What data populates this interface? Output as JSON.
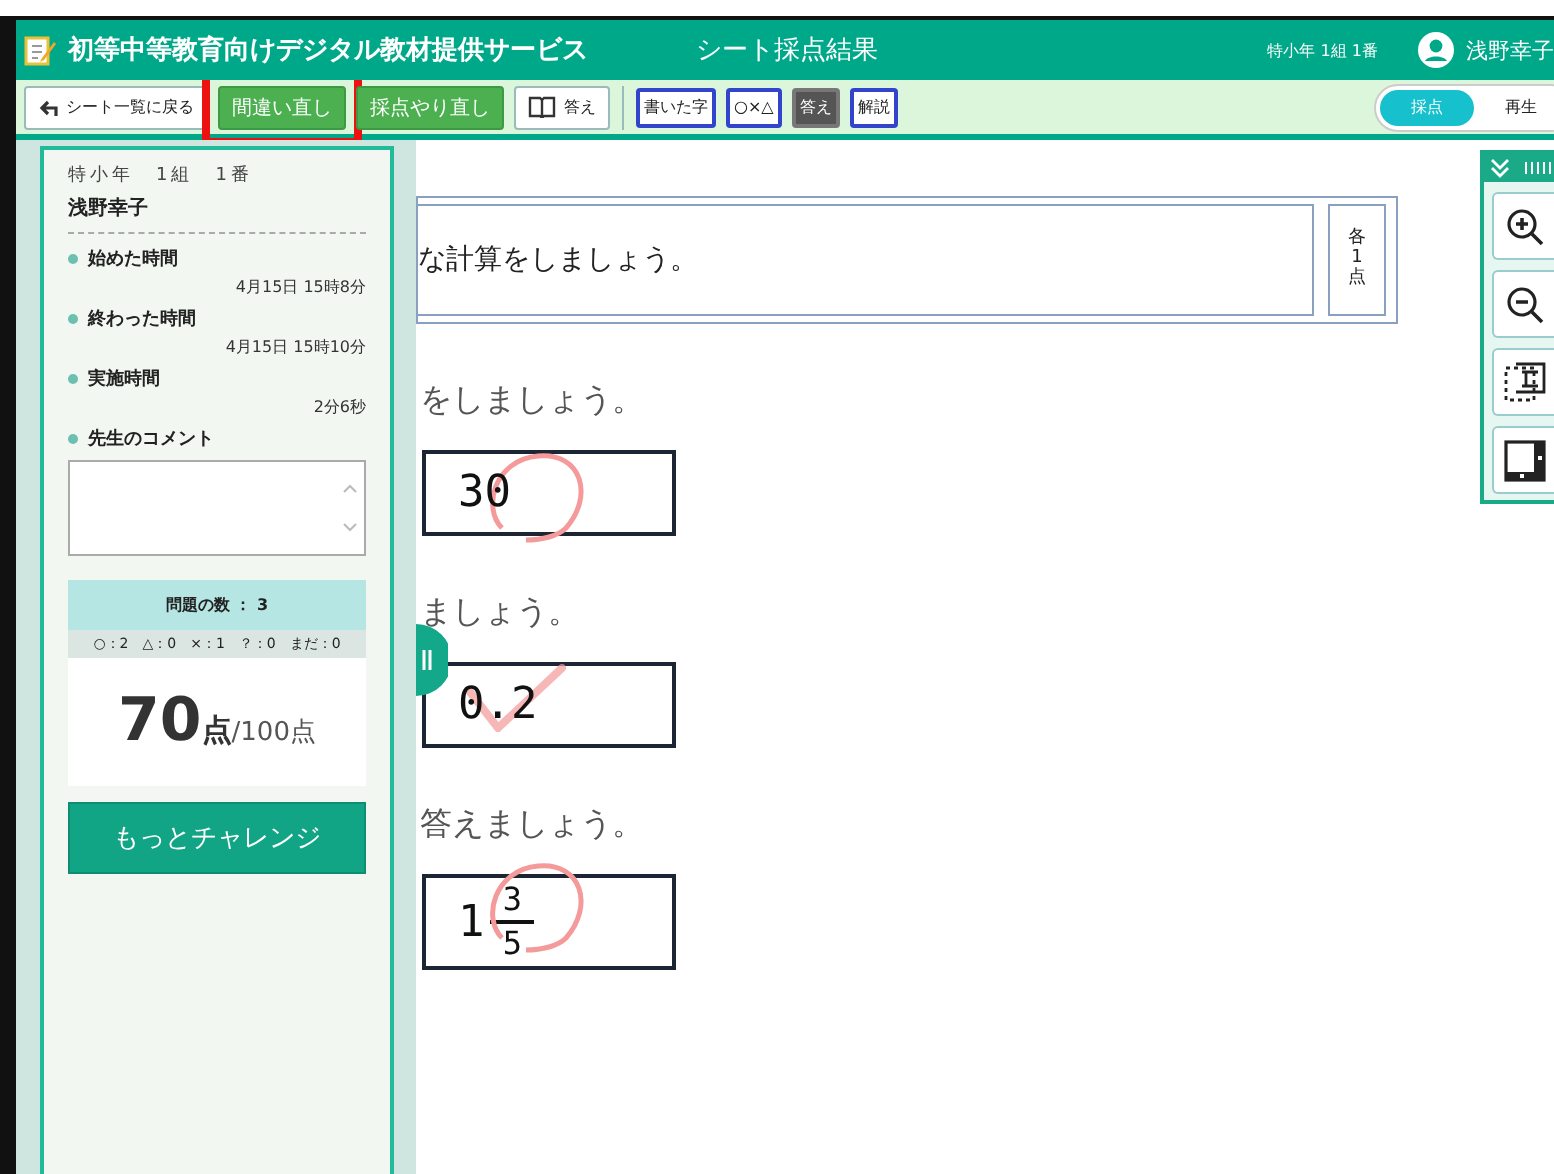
{
  "header": {
    "app_title": "初等中等教育向けデジタル教材提供サービス",
    "page_title": "シート採点結果",
    "class_info": "特小年 1組 1番",
    "user_name": "浅野幸子"
  },
  "toolbar": {
    "buttons": [
      {
        "kind": "back",
        "label": "シート一覧に戻る",
        "highlighted": false
      },
      {
        "kind": "action",
        "label": "間違い直し",
        "highlighted": true
      },
      {
        "kind": "action",
        "label": "採点やり直し",
        "highlighted": false
      },
      {
        "kind": "book",
        "label": "答え",
        "highlighted": false
      }
    ],
    "toggles": [
      {
        "label": "書いた字",
        "selected": false
      },
      {
        "label": "○×△",
        "selected": false
      },
      {
        "label": "答え",
        "selected": true
      },
      {
        "label": "解説",
        "selected": false
      }
    ],
    "mode": [
      {
        "label": "採点",
        "selected": true
      },
      {
        "label": "再生",
        "selected": false
      }
    ]
  },
  "student": {
    "class_line": "特小年　1組　1番",
    "name": "浅野幸子",
    "info": [
      {
        "label": "始めた時間",
        "value": "4月15日 15時8分"
      },
      {
        "label": "終わった時間",
        "value": "4月15日 15時10分"
      },
      {
        "label": "実施時間",
        "value": "2分6秒"
      }
    ],
    "comment_label": "先生のコメント",
    "summary": {
      "title": "問題の数 ： 3",
      "counts": "○：2　△：0　×：1　？：0　まだ：0",
      "score": "70",
      "score_unit": "点",
      "total": "/100点"
    },
    "retry_button": "もっとチャレンジ"
  },
  "sheet": {
    "heading": "な計算をしましょう。",
    "points": "各1点",
    "questions": [
      {
        "prompt": "をしましょう。",
        "answer": {
          "kind": "number",
          "text": "30"
        },
        "correct": true
      },
      {
        "prompt": "ましょう。",
        "answer": {
          "kind": "number",
          "text": "0.2"
        },
        "correct": false
      },
      {
        "prompt": "答えましょう。",
        "answer": {
          "kind": "fraction",
          "whole": "1",
          "numerator": "3",
          "denominator": "5"
        },
        "correct": true
      }
    ]
  }
}
